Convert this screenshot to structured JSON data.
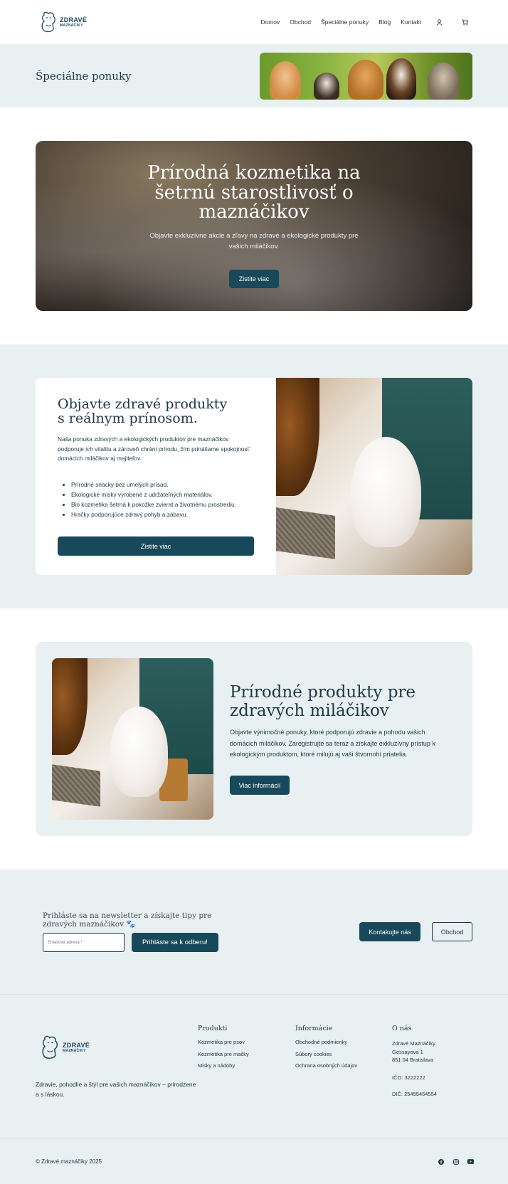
{
  "header": {
    "logo": {
      "line1": "ZDRAVÉ",
      "line2": "MAZNÁČIKY"
    },
    "nav": [
      "Domov",
      "Obchod",
      "Špeciálne ponuky",
      "Blog",
      "Kontakt"
    ],
    "icons": [
      "user-icon",
      "cart-icon"
    ]
  },
  "page": {
    "title": "Špeciálne ponuky"
  },
  "hero": {
    "title": "Prírodná kozmetika na šetrnú starostlivosť o maznáčikov",
    "text": "Objavte exkluzívne akcie a zľavy na zdravé a ekologické produkty pre vašich miláčikov.",
    "button": "Zistite viac"
  },
  "section2": {
    "title_line1": "Objavte zdravé produkty",
    "title_line2": "s reálnym prínosom.",
    "description": "Naša ponuka zdravých a ekologických produktov pre maznáčikov podporuje ich vitalitu a zároveň chráni prírodu, čím prinášame spokojnosť domácich miláčikov aj majiteľov.",
    "bullets": [
      "Prírodné snacky bez umelých prísad.",
      "Ekologické misky vyrobené z udržateľných materiálov.",
      "Bio kozmetika šetrná k pokožke zvierat a životnému prostrediu.",
      "Hračky podporujúce zdravý pohyb a zábavu."
    ],
    "button": "Zistite viac"
  },
  "section3": {
    "title": "Prírodné produkty pre zdravých miláčikov",
    "text": "Objavte výnimočné ponuky, ktoré podporujú zdravie a pohodu vašich domácich miláčikov. Zaregistrujte sa teraz a získajte exkluzívny prístup k ekologickým produktom, ktoré milujú aj vaši štvornohí priatelia.",
    "button": "Viac informácií"
  },
  "newsletter": {
    "text": "Prihláste sa na newsletter a získajte tipy pre zdravých maznáčikov 🐾",
    "input_placeholder": "Emailová adresa *",
    "subscribe_button": "Prihláste sa k odberu!",
    "contact_button": "Kontakujte nás",
    "shop_button": "Obchod"
  },
  "footer": {
    "tagline": "Zdravie, pohodlie a štýl pre vašich maznáčikov – prirodzene a s láskou.",
    "columns": {
      "products": {
        "title": "Produkti",
        "items": [
          "Kozmetika pre psov",
          "Kozmetika pre mačky",
          "Misky a nádoby"
        ]
      },
      "info": {
        "title": "Informácie",
        "items": [
          "Obchodné podmienky",
          "Súbory cookies",
          "Ochrana osobných údajov"
        ]
      },
      "about": {
        "title": "O nás",
        "address": [
          "Zdravé Maznáčiky",
          "Gessayova 1",
          "851 04 Bratislava"
        ],
        "ico": "IČO: 3222222",
        "dic": "DIČ: 25455454554"
      }
    },
    "copyright": "© Zdravé maznáčiky 2025",
    "socials": [
      "facebook-icon",
      "instagram-icon",
      "youtube-icon"
    ]
  },
  "colors": {
    "primary": "#18495a",
    "text": "#1d3944",
    "band": "#e9f0f1"
  }
}
